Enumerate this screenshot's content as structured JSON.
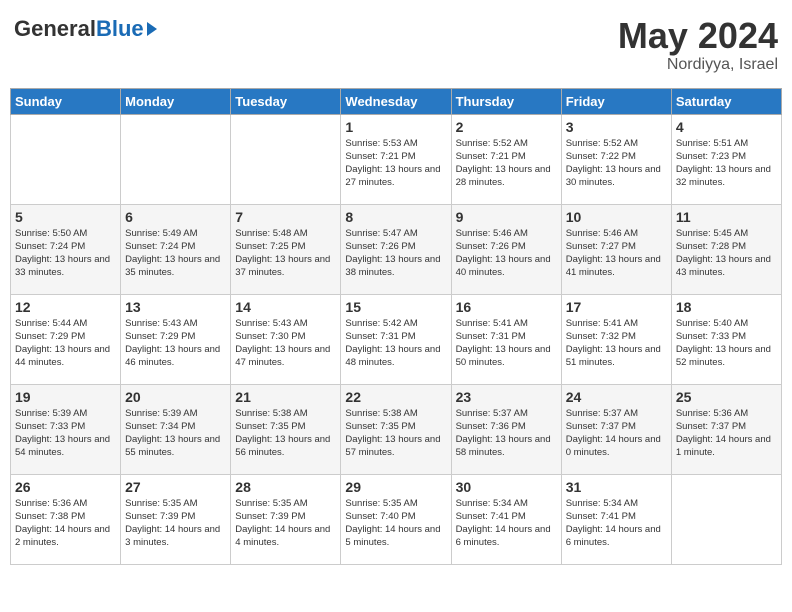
{
  "header": {
    "logo_general": "General",
    "logo_blue": "Blue",
    "month": "May 2024",
    "location": "Nordiyya, Israel"
  },
  "days_of_week": [
    "Sunday",
    "Monday",
    "Tuesday",
    "Wednesday",
    "Thursday",
    "Friday",
    "Saturday"
  ],
  "weeks": [
    [
      {
        "day": "",
        "info": ""
      },
      {
        "day": "",
        "info": ""
      },
      {
        "day": "",
        "info": ""
      },
      {
        "day": "1",
        "info": "Sunrise: 5:53 AM\nSunset: 7:21 PM\nDaylight: 13 hours\nand 27 minutes."
      },
      {
        "day": "2",
        "info": "Sunrise: 5:52 AM\nSunset: 7:21 PM\nDaylight: 13 hours\nand 28 minutes."
      },
      {
        "day": "3",
        "info": "Sunrise: 5:52 AM\nSunset: 7:22 PM\nDaylight: 13 hours\nand 30 minutes."
      },
      {
        "day": "4",
        "info": "Sunrise: 5:51 AM\nSunset: 7:23 PM\nDaylight: 13 hours\nand 32 minutes."
      }
    ],
    [
      {
        "day": "5",
        "info": "Sunrise: 5:50 AM\nSunset: 7:24 PM\nDaylight: 13 hours\nand 33 minutes."
      },
      {
        "day": "6",
        "info": "Sunrise: 5:49 AM\nSunset: 7:24 PM\nDaylight: 13 hours\nand 35 minutes."
      },
      {
        "day": "7",
        "info": "Sunrise: 5:48 AM\nSunset: 7:25 PM\nDaylight: 13 hours\nand 37 minutes."
      },
      {
        "day": "8",
        "info": "Sunrise: 5:47 AM\nSunset: 7:26 PM\nDaylight: 13 hours\nand 38 minutes."
      },
      {
        "day": "9",
        "info": "Sunrise: 5:46 AM\nSunset: 7:26 PM\nDaylight: 13 hours\nand 40 minutes."
      },
      {
        "day": "10",
        "info": "Sunrise: 5:46 AM\nSunset: 7:27 PM\nDaylight: 13 hours\nand 41 minutes."
      },
      {
        "day": "11",
        "info": "Sunrise: 5:45 AM\nSunset: 7:28 PM\nDaylight: 13 hours\nand 43 minutes."
      }
    ],
    [
      {
        "day": "12",
        "info": "Sunrise: 5:44 AM\nSunset: 7:29 PM\nDaylight: 13 hours\nand 44 minutes."
      },
      {
        "day": "13",
        "info": "Sunrise: 5:43 AM\nSunset: 7:29 PM\nDaylight: 13 hours\nand 46 minutes."
      },
      {
        "day": "14",
        "info": "Sunrise: 5:43 AM\nSunset: 7:30 PM\nDaylight: 13 hours\nand 47 minutes."
      },
      {
        "day": "15",
        "info": "Sunrise: 5:42 AM\nSunset: 7:31 PM\nDaylight: 13 hours\nand 48 minutes."
      },
      {
        "day": "16",
        "info": "Sunrise: 5:41 AM\nSunset: 7:31 PM\nDaylight: 13 hours\nand 50 minutes."
      },
      {
        "day": "17",
        "info": "Sunrise: 5:41 AM\nSunset: 7:32 PM\nDaylight: 13 hours\nand 51 minutes."
      },
      {
        "day": "18",
        "info": "Sunrise: 5:40 AM\nSunset: 7:33 PM\nDaylight: 13 hours\nand 52 minutes."
      }
    ],
    [
      {
        "day": "19",
        "info": "Sunrise: 5:39 AM\nSunset: 7:33 PM\nDaylight: 13 hours\nand 54 minutes."
      },
      {
        "day": "20",
        "info": "Sunrise: 5:39 AM\nSunset: 7:34 PM\nDaylight: 13 hours\nand 55 minutes."
      },
      {
        "day": "21",
        "info": "Sunrise: 5:38 AM\nSunset: 7:35 PM\nDaylight: 13 hours\nand 56 minutes."
      },
      {
        "day": "22",
        "info": "Sunrise: 5:38 AM\nSunset: 7:35 PM\nDaylight: 13 hours\nand 57 minutes."
      },
      {
        "day": "23",
        "info": "Sunrise: 5:37 AM\nSunset: 7:36 PM\nDaylight: 13 hours\nand 58 minutes."
      },
      {
        "day": "24",
        "info": "Sunrise: 5:37 AM\nSunset: 7:37 PM\nDaylight: 14 hours\nand 0 minutes."
      },
      {
        "day": "25",
        "info": "Sunrise: 5:36 AM\nSunset: 7:37 PM\nDaylight: 14 hours\nand 1 minute."
      }
    ],
    [
      {
        "day": "26",
        "info": "Sunrise: 5:36 AM\nSunset: 7:38 PM\nDaylight: 14 hours\nand 2 minutes."
      },
      {
        "day": "27",
        "info": "Sunrise: 5:35 AM\nSunset: 7:39 PM\nDaylight: 14 hours\nand 3 minutes."
      },
      {
        "day": "28",
        "info": "Sunrise: 5:35 AM\nSunset: 7:39 PM\nDaylight: 14 hours\nand 4 minutes."
      },
      {
        "day": "29",
        "info": "Sunrise: 5:35 AM\nSunset: 7:40 PM\nDaylight: 14 hours\nand 5 minutes."
      },
      {
        "day": "30",
        "info": "Sunrise: 5:34 AM\nSunset: 7:41 PM\nDaylight: 14 hours\nand 6 minutes."
      },
      {
        "day": "31",
        "info": "Sunrise: 5:34 AM\nSunset: 7:41 PM\nDaylight: 14 hours\nand 6 minutes."
      },
      {
        "day": "",
        "info": ""
      }
    ]
  ]
}
